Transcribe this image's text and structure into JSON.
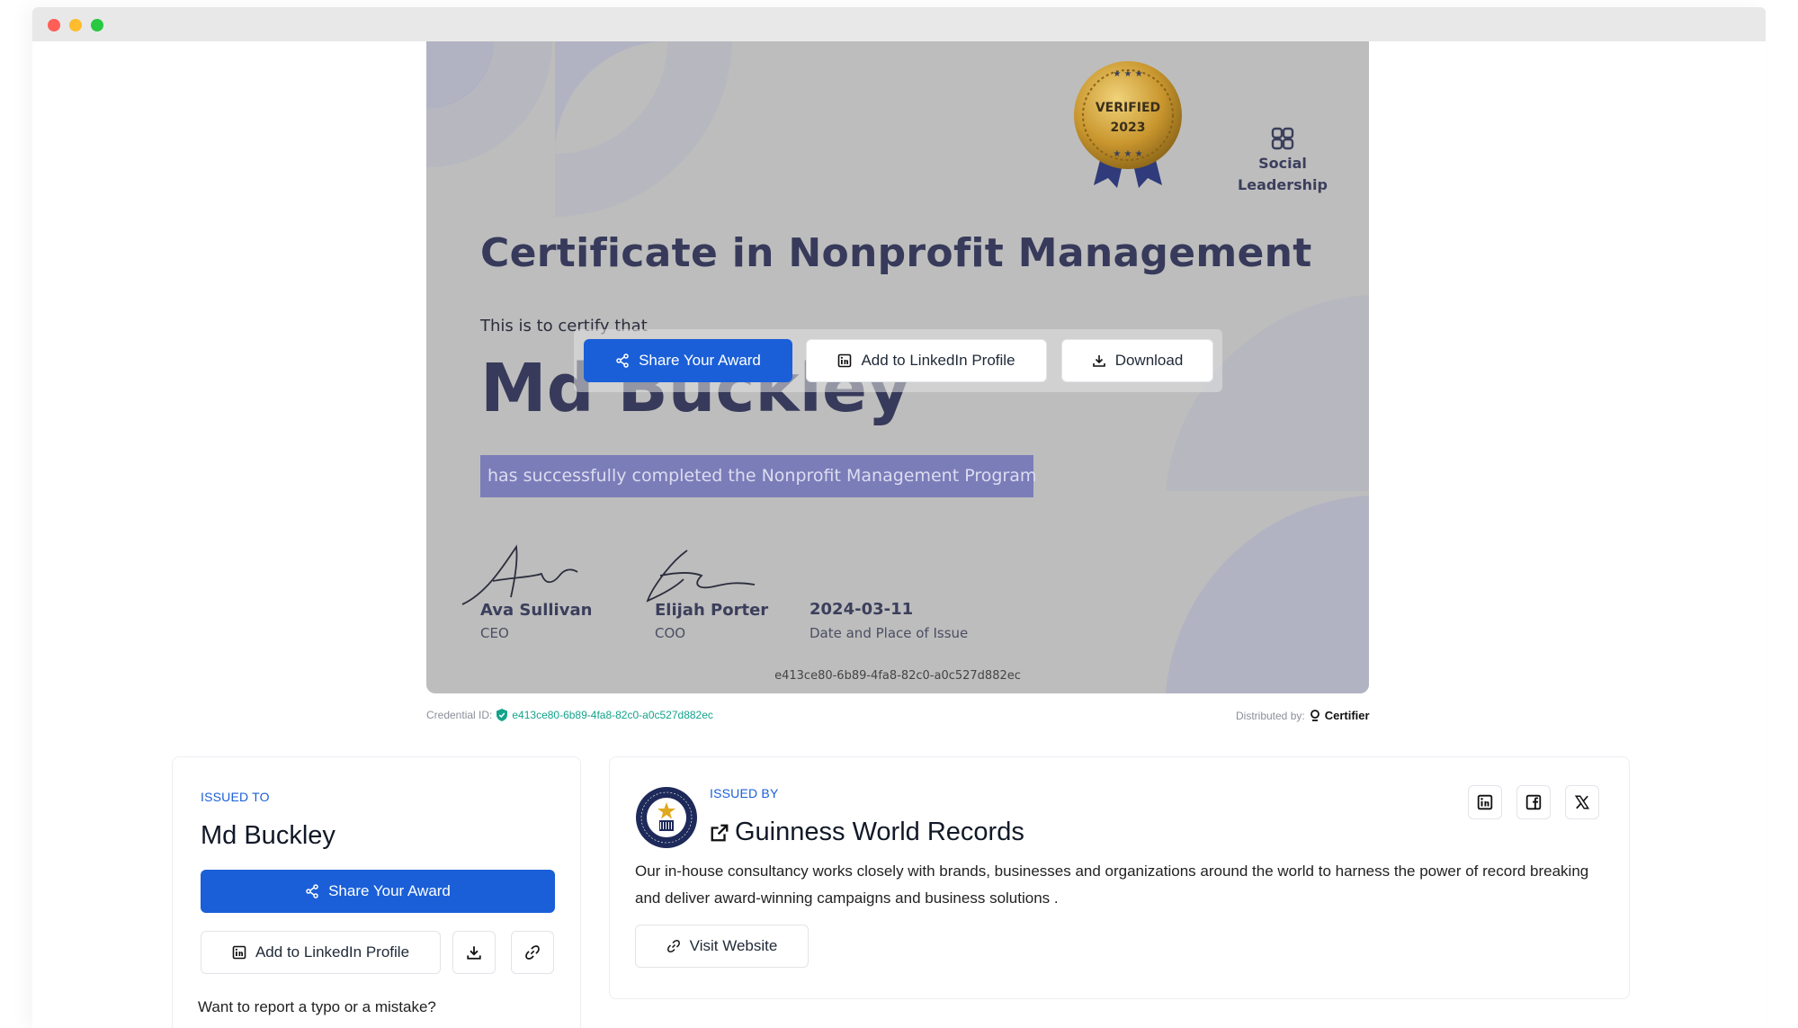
{
  "certificate": {
    "badge_text": [
      "VERIFIED",
      "2023"
    ],
    "category": [
      "Social",
      "Leadership"
    ],
    "title": "Certificate in Nonprofit Management",
    "intro": "This is to certify that",
    "recipient": "Md Buckley",
    "description": "has successfully completed the Nonprofit Management Program",
    "signatories": [
      {
        "name": "Ava Sullivan",
        "role": "CEO"
      },
      {
        "name": "Elijah Porter",
        "role": "COO"
      }
    ],
    "issue_date": "2024-03-11",
    "issue_label": "Date and Place of Issue",
    "credential_id": "e413ce80-6b89-4fa8-82c0-a0c527d882ec"
  },
  "overlay_actions": {
    "share": "Share Your Award",
    "linkedin": "Add to LinkedIn Profile",
    "download": "Download"
  },
  "credential_line": {
    "label": "Credential ID:",
    "id": "e413ce80-6b89-4fa8-82c0-a0c527d882ec",
    "distributed_label": "Distributed by:",
    "distributor": "Certifier"
  },
  "issued_to": {
    "eyebrow": "ISSUED TO",
    "name": "Md Buckley",
    "share": "Share Your Award",
    "linkedin": "Add to LinkedIn Profile",
    "report": "Want to report a typo or a mistake?"
  },
  "issued_by": {
    "eyebrow": "ISSUED BY",
    "name": "Guinness World Records",
    "description": "Our in-house consultancy works closely with brands, businesses and organizations around the world to harness the power of record breaking and deliver award-winning campaigns and business solutions .",
    "visit": "Visit Website",
    "logo_text": "GUINNESS WORLD RECORDS"
  },
  "colors": {
    "primary": "#1a5fd8",
    "certificate_bg": "#bdbdbd",
    "certificate_accent": "#7b7db9",
    "credential_id": "#14a38b"
  }
}
